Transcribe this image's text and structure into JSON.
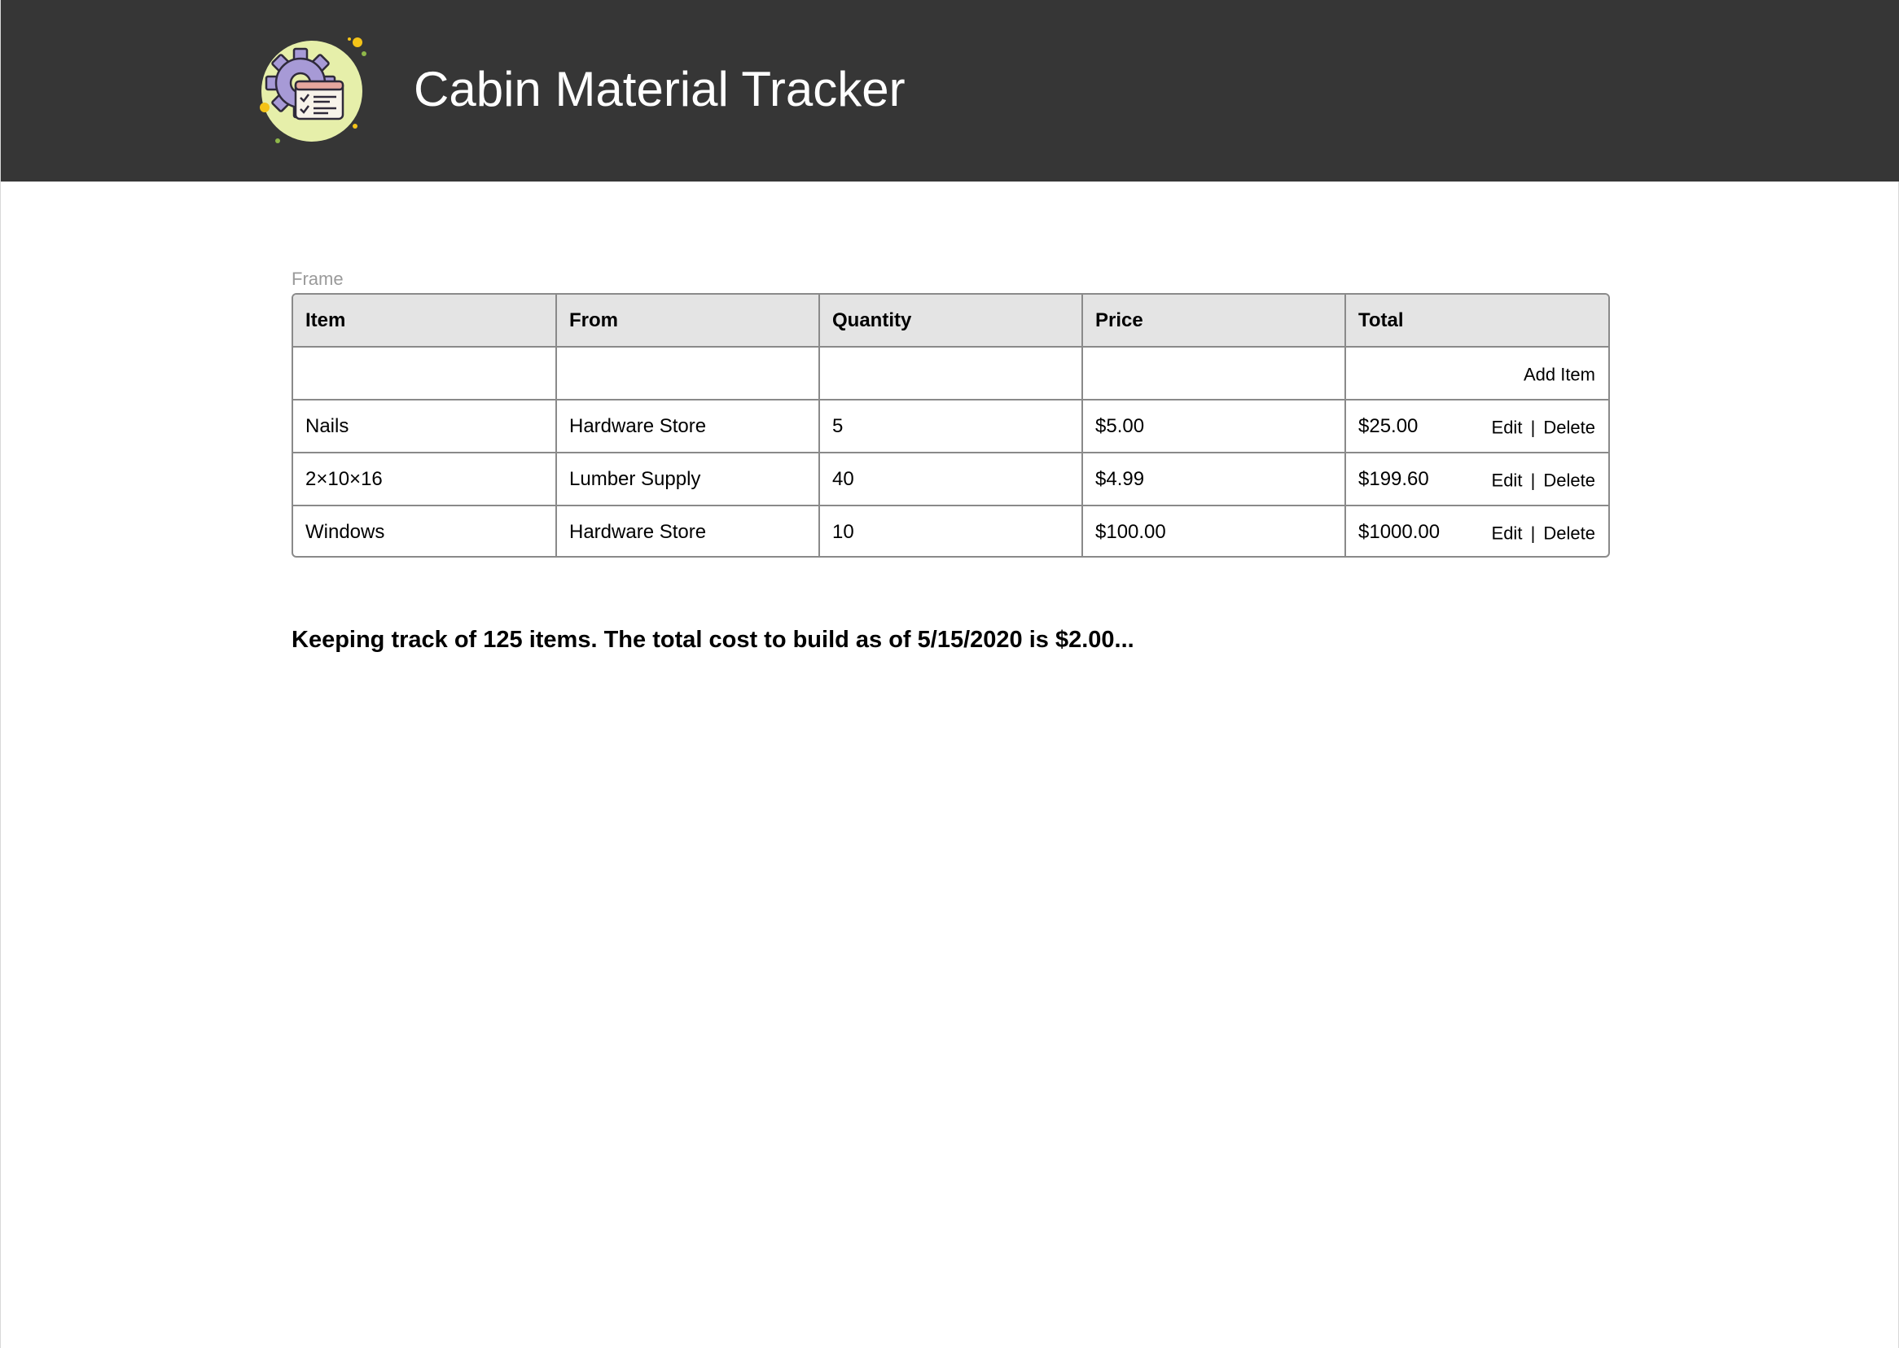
{
  "header": {
    "title": "Cabin Material Tracker",
    "logo_icon": "gear-checklist-icon",
    "background": "#363636"
  },
  "frame_label": "Frame",
  "table": {
    "columns": [
      "Item",
      "From",
      "Quantity",
      "Price",
      "Total"
    ],
    "add_item_label": "Add Item",
    "edit_label": "Edit",
    "separator": "|",
    "delete_label": "Delete",
    "rows": [
      {
        "item": "Nails",
        "from": "Hardware Store",
        "quantity": "5",
        "price": "$5.00",
        "total": "$25.00"
      },
      {
        "item": "2×10×16",
        "from": "Lumber Supply",
        "quantity": "40",
        "price": "$4.99",
        "total": "$199.60"
      },
      {
        "item": "Windows",
        "from": "Hardware Store",
        "quantity": "10",
        "price": "$100.00",
        "total": "$1000.00"
      }
    ]
  },
  "summary": "Keeping track of 125 items. The total cost to build as of 5/15/2020 is $2.00..."
}
